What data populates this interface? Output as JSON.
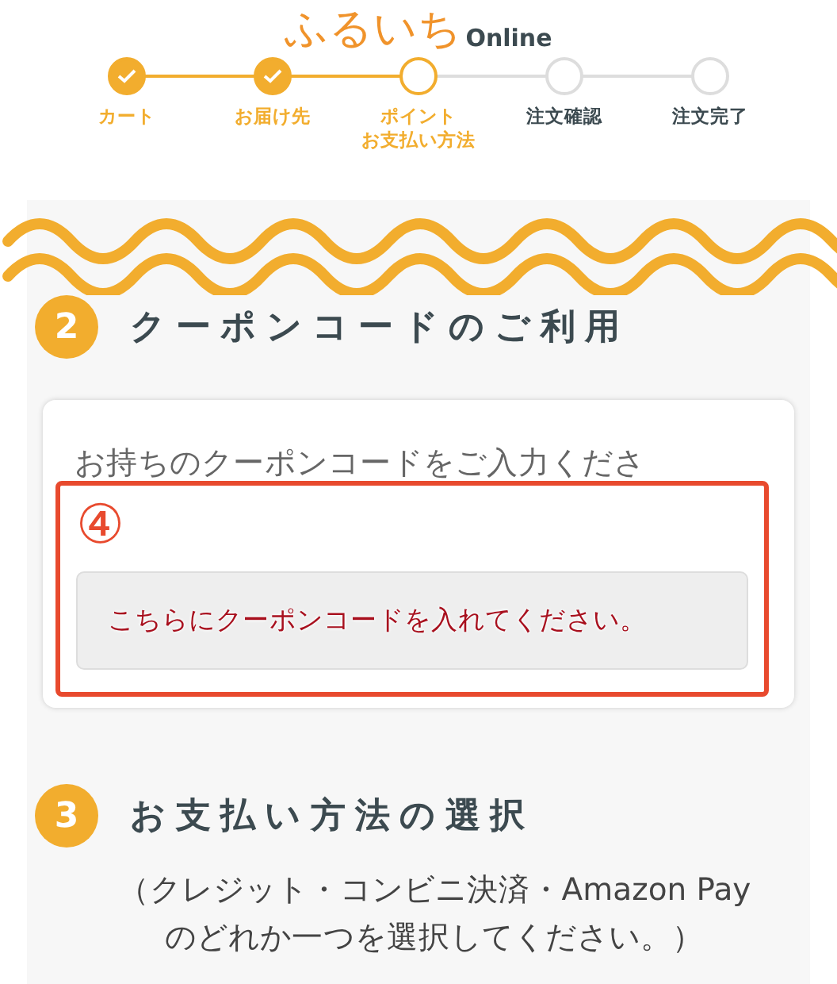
{
  "logo": {
    "main": "ふるいち",
    "sub": "Online"
  },
  "steps": [
    {
      "label_lines": [
        "カート"
      ],
      "done": true,
      "current": false
    },
    {
      "label_lines": [
        "お届け先"
      ],
      "done": true,
      "current": false
    },
    {
      "label_lines": [
        "ポイント",
        "お支払い方法"
      ],
      "done": false,
      "current": true
    },
    {
      "label_lines": [
        "注文確認"
      ],
      "done": false,
      "current": false
    },
    {
      "label_lines": [
        "注文完了"
      ],
      "done": false,
      "current": false
    }
  ],
  "coupon_section": {
    "number": "2",
    "title": "クーポンコードのご利用",
    "instruction": "お持ちのクーポンコードをご入力くださ",
    "annotation": {
      "marker": "④",
      "note": "こちらにクーポンコードを入れてください。"
    }
  },
  "payment_section": {
    "number": "3",
    "title": "お支払い方法の選択",
    "description": "（クレジット・コンビニ決済・Amazon Payのどれか一つを選択してください。）"
  }
}
